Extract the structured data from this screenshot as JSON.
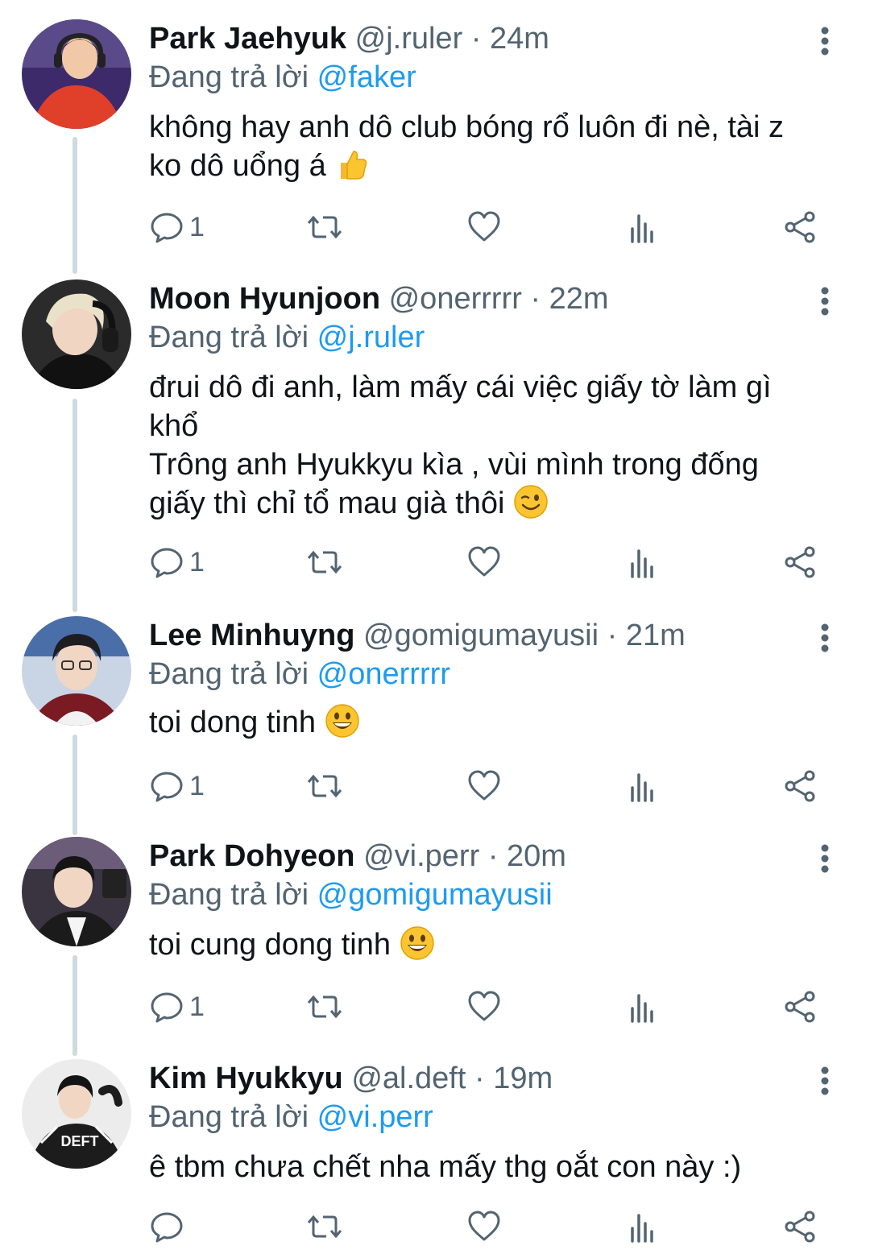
{
  "reply_prefix": "Đang trả lời",
  "colors": {
    "name": "#0f1419",
    "muted": "#536471",
    "link": "#1d9bf0",
    "thread_line": "#cfd9de"
  },
  "icons": [
    "more-vertical-icon",
    "reply-icon",
    "retweet-icon",
    "like-icon",
    "views-icon",
    "share-icon",
    "thumbs-up-emoji",
    "wink-emoji",
    "grin-emoji"
  ],
  "tweets": [
    {
      "name": "Park Jaehyuk",
      "handle": "@j.ruler",
      "sep": "·",
      "time": "24m",
      "reply_to": "@faker",
      "lines": [
        "không hay anh dô club bóng rổ luôn đi nè, tài z",
        "ko dô uổng á"
      ],
      "emoji": "thumbs-up",
      "reply_count": "1"
    },
    {
      "name": "Moon Hyunjoon",
      "handle": "@onerrrrr",
      "sep": "·",
      "time": "22m",
      "reply_to": "@j.ruler",
      "lines": [
        "đrui dô đi anh, làm mấy cái việc giấy tờ làm gì",
        "khổ",
        "Trông anh Hyukkyu kìa , vùi mình trong đống",
        "giấy thì chỉ tổ mau già thôi"
      ],
      "emoji": "wink",
      "reply_count": "1"
    },
    {
      "name": "Lee Minhuyng",
      "handle": "@gomigumayusii",
      "sep": "·",
      "time": "21m",
      "reply_to": "@onerrrrr",
      "lines": [
        "toi dong tinh"
      ],
      "emoji": "grin",
      "reply_count": "1"
    },
    {
      "name": "Park Dohyeon",
      "handle": "@vi.perr",
      "sep": "·",
      "time": "20m",
      "reply_to": "@gomigumayusii",
      "lines": [
        "toi cung dong tinh"
      ],
      "emoji": "grin",
      "reply_count": "1"
    },
    {
      "name": "Kim Hyukkyu",
      "handle": "@al.deft",
      "sep": "·",
      "time": "19m",
      "reply_to": "@vi.perr",
      "lines": [
        "ê tbm chưa chết nha mấy thg oắt con này :)"
      ],
      "emoji": "",
      "reply_count": "",
      "avatar_text": "DEFT"
    }
  ]
}
